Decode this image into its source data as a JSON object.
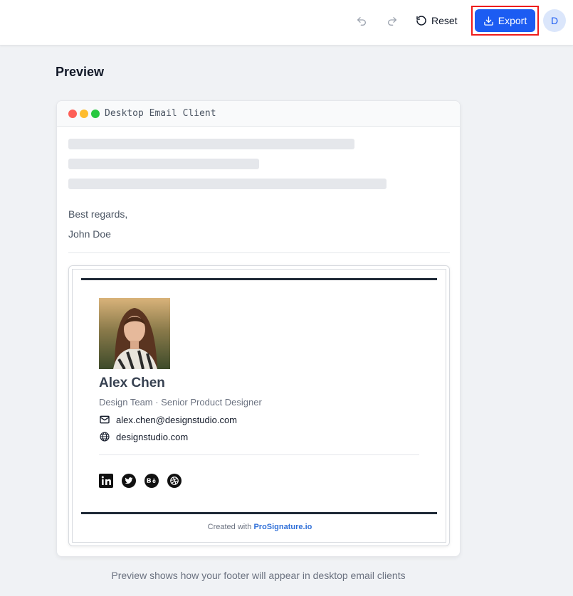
{
  "toolbar": {
    "undo_icon": "undo-icon",
    "redo_icon": "redo-icon",
    "reset_label": "Reset",
    "export_label": "Export",
    "avatar_initial": "D",
    "accent_color": "#1c5cf2"
  },
  "preview": {
    "title": "Preview",
    "client_label": "Desktop Email Client",
    "caption": "Preview shows how your footer will appear in desktop email clients"
  },
  "email": {
    "closing": "Best regards,",
    "sender": "John Doe"
  },
  "signature": {
    "name": "Alex Chen",
    "role": "Design Team · Senior Product Designer",
    "email": "alex.chen@designstudio.com",
    "website": "designstudio.com",
    "social_icons": [
      "linkedin-icon",
      "twitter-icon",
      "behance-icon",
      "dribbble-icon"
    ],
    "credit_prefix": "Created with ",
    "credit_brand": "ProSignature.io"
  }
}
